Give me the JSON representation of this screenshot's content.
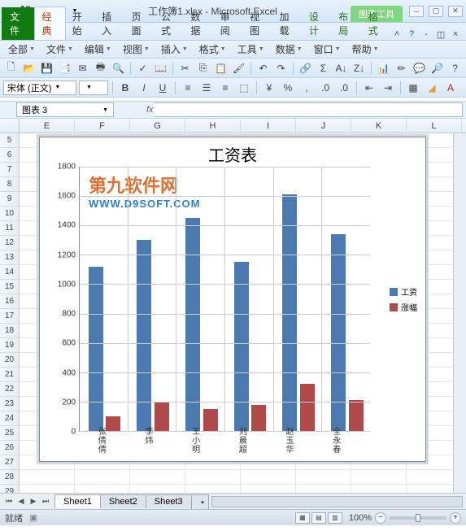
{
  "titlebar": {
    "doc_title": "工作簿1.xlsx - Microsoft Excel",
    "context_tab": "图表工具"
  },
  "ribbon": {
    "file": "文件",
    "tabs": [
      "经典",
      "开始",
      "插入",
      "页面",
      "公式",
      "数据",
      "审阅",
      "视图",
      "加载",
      "设计",
      "布局",
      "格式"
    ]
  },
  "menus": [
    "全部",
    "文件",
    "编辑",
    "视图",
    "插入",
    "格式",
    "工具",
    "数据",
    "窗口",
    "帮助"
  ],
  "toolbar2": {
    "font_name": "宋体 (正文)",
    "font_size": ""
  },
  "name_box": "图表 3",
  "fx_label": "fx",
  "columns": [
    "E",
    "F",
    "G",
    "H",
    "I",
    "J",
    "K",
    "L"
  ],
  "rows_start": 5,
  "rows_end": 29,
  "chart_data": {
    "type": "bar",
    "title": "工资表",
    "categories": [
      "张倩倩",
      "李炜",
      "王小明",
      "刘晨超",
      "赵玉华",
      "全永春"
    ],
    "series": [
      {
        "name": "工资",
        "values": [
          1120,
          1300,
          1450,
          1150,
          1610,
          1340
        ],
        "color": "#4a7ab0"
      },
      {
        "name": "涨幅",
        "values": [
          100,
          200,
          150,
          180,
          320,
          210
        ],
        "color": "#b04a4a"
      }
    ],
    "ylim": [
      0,
      1800
    ],
    "ystep": 200,
    "xlabel": "",
    "ylabel": ""
  },
  "watermark": {
    "line1": "第九软件网",
    "line2": "WWW.D9SOFT.COM"
  },
  "sheets": [
    "Sheet1",
    "Sheet2",
    "Sheet3"
  ],
  "status": {
    "ready": "就绪",
    "zoom": "100%"
  }
}
